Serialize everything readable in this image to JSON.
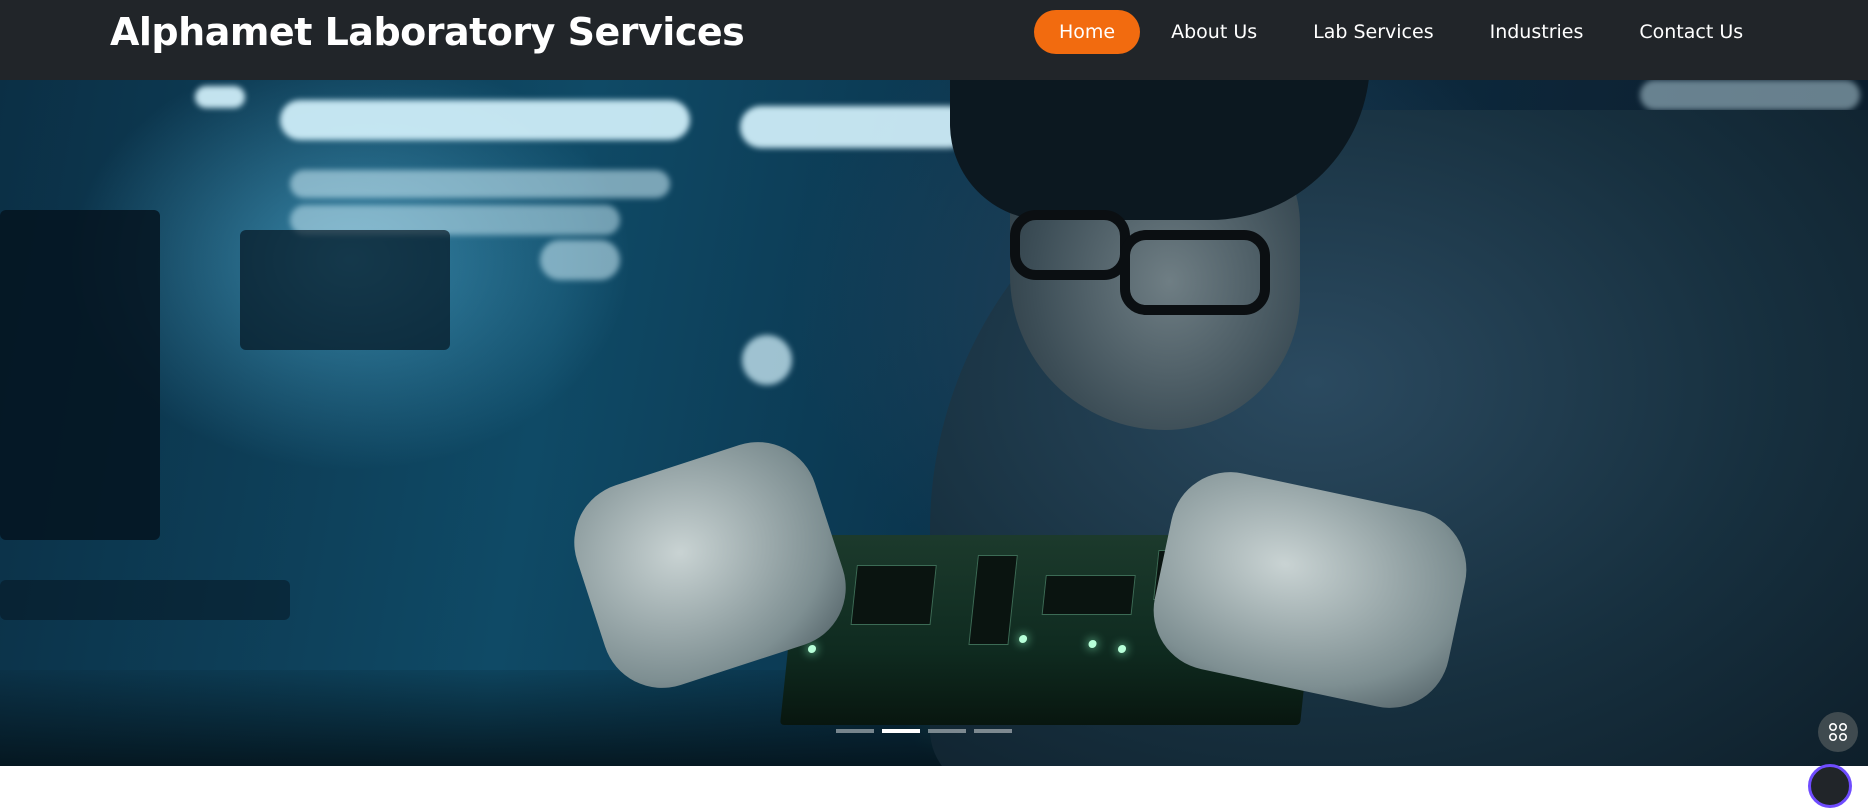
{
  "header": {
    "brand": "Alphamet Laboratory Services"
  },
  "nav": {
    "items": [
      {
        "label": "Home",
        "active": true
      },
      {
        "label": "About Us",
        "active": false
      },
      {
        "label": "Lab Services",
        "active": false
      },
      {
        "label": "Industries",
        "active": false
      },
      {
        "label": "Contact Us",
        "active": false
      }
    ]
  },
  "carousel": {
    "slide_count": 4,
    "active_index": 1
  },
  "colors": {
    "navbar_bg": "#212529",
    "accent": "#f26b0f",
    "text": "#ffffff"
  },
  "icons": {
    "floating_button": "apps-grid-icon"
  }
}
